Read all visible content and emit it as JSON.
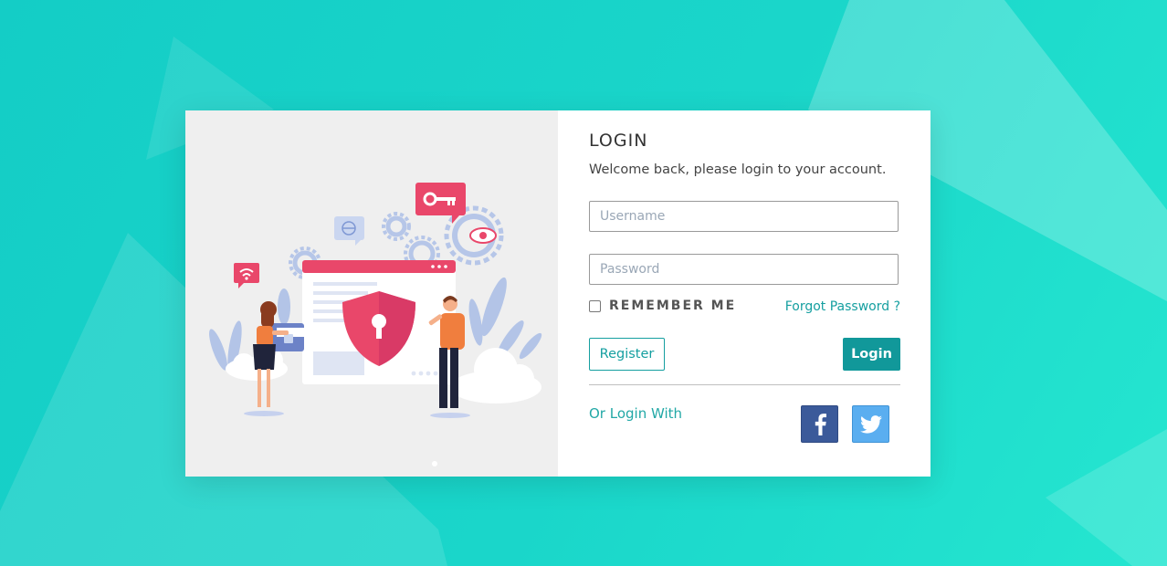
{
  "login_form": {
    "title": "LOGIN",
    "subtitle": "Welcome back, please login to your account.",
    "username_placeholder": "Username",
    "password_placeholder": "Password",
    "remember_label": "REMEMBER ME",
    "remember_checked": false,
    "forgot_label": "Forgot Password ?",
    "register_label": "Register",
    "login_label": "Login",
    "or_login_with": "Or Login With"
  },
  "social": {
    "facebook_icon": "facebook-icon",
    "twitter_icon": "twitter-icon"
  },
  "illustration": {
    "subject": "security-illustration"
  },
  "colors": {
    "background": "#1ad6ca",
    "accent": "#11989a",
    "facebook": "#3b5a9a",
    "twitter": "#5aaef0",
    "shield": "#e9476a"
  }
}
